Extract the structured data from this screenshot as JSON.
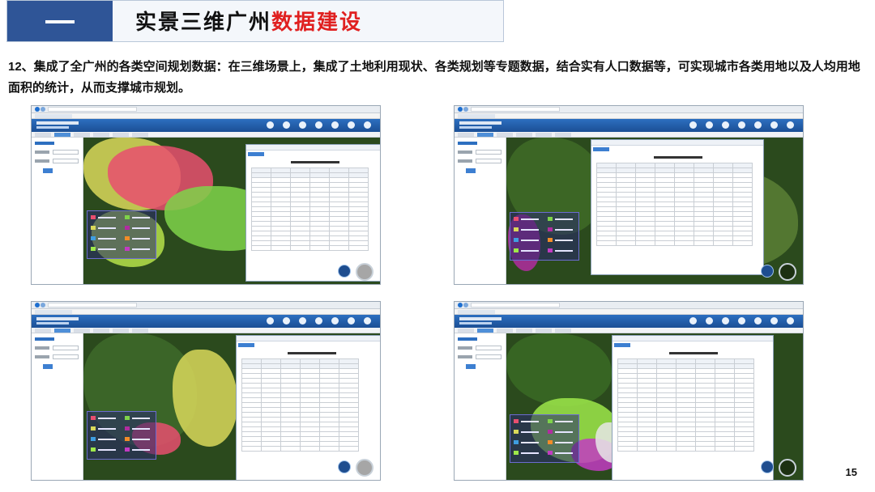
{
  "header": {
    "badge_symbol": "一",
    "title_plain": "实景三维广州",
    "title_accent": "数据建设",
    "accent_color": "#e02020",
    "badge_color": "#2f5597"
  },
  "description": "12、集成了全广州的各类空间规划数据：在三维场景上，集成了土地利用现状、各类规划等专题数据，结合实有人口数据等，可实现城市各类用地以及人均用地面积的统计，从而支撑城市规划。",
  "page_number": "15",
  "screenshots": [
    {
      "position": "top-left",
      "map_theme": "land-use-status"
    },
    {
      "position": "top-right",
      "map_theme": "regulatory-plan"
    },
    {
      "position": "bottom-left",
      "map_theme": "land-use-plan"
    },
    {
      "position": "bottom-right",
      "map_theme": "population-statistics"
    }
  ]
}
